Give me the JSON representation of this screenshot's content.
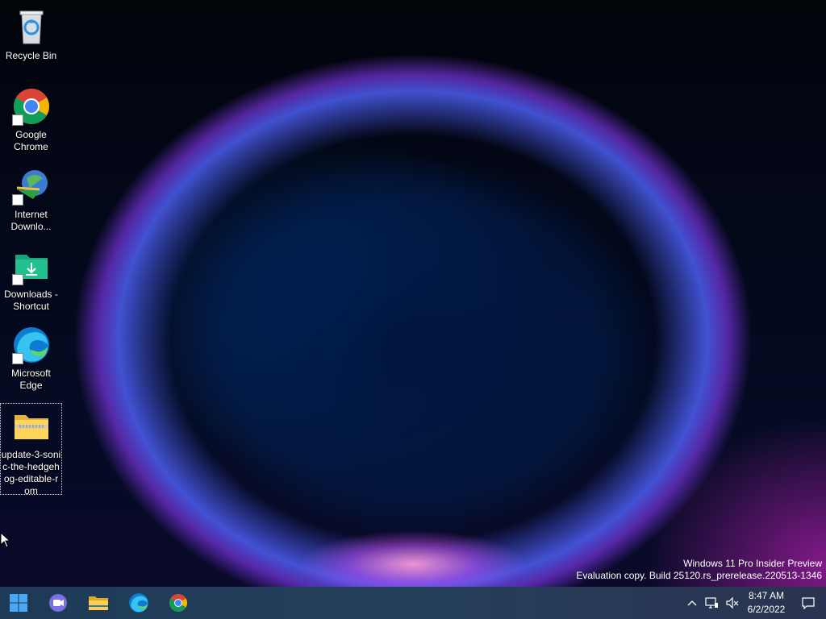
{
  "desktop": {
    "icons": [
      {
        "label": "Recycle Bin",
        "icon": "recycle-bin-icon"
      },
      {
        "label": "Google Chrome",
        "icon": "chrome-icon"
      },
      {
        "label": "Internet Downlo...",
        "icon": "internet-download-manager-icon"
      },
      {
        "label": "Downloads - Shortcut",
        "icon": "downloads-folder-icon"
      },
      {
        "label": "Microsoft Edge",
        "icon": "edge-icon"
      },
      {
        "label": "update-3-sonic-the-hedgehog-editable-rom",
        "icon": "zip-folder-icon"
      }
    ],
    "watermark": {
      "line1": "Windows 11 Pro Insider Preview",
      "line2": "Evaluation copy. Build 25120.rs_prerelease.220513-1346"
    }
  },
  "taskbar": {
    "pinned": [
      {
        "name": "start-button",
        "icon": "windows-logo-icon"
      },
      {
        "name": "teams-chat-button",
        "icon": "teams-chat-icon"
      },
      {
        "name": "file-explorer-button",
        "icon": "file-explorer-icon"
      },
      {
        "name": "edge-taskbar-button",
        "icon": "edge-icon"
      },
      {
        "name": "chrome-taskbar-button",
        "icon": "chrome-icon"
      }
    ],
    "clock": {
      "time": "8:47 AM",
      "date": "6/2/2022"
    },
    "tray_icons": [
      "chevron-up-icon",
      "network-icon",
      "volume-muted-icon",
      "notification-icon"
    ]
  }
}
